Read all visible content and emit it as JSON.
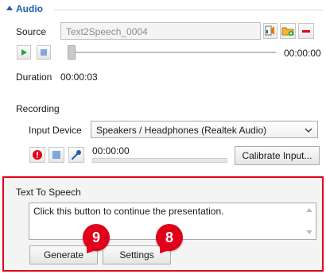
{
  "audio_section": {
    "title": "Audio",
    "source_label": "Source",
    "source_value": "Text2Speech_0004",
    "playback_time": "00:00:00",
    "duration_label": "Duration",
    "duration_value": "00:00:03"
  },
  "recording_section": {
    "title": "Recording",
    "input_device_label": "Input Device",
    "input_device_value": "Speakers / Headphones (Realtek Audio)",
    "record_time": "00:00:00",
    "calibrate_label": "Calibrate Input..."
  },
  "tts_section": {
    "title": "Text To Speech",
    "text": "Click this button to continue the presentation.",
    "generate_label": "Generate",
    "settings_label": "Settings"
  },
  "callouts": {
    "generate": "9",
    "settings": "8"
  },
  "colors": {
    "accent_blue": "#1f5fa8",
    "highlight_red": "#e0001a",
    "play_green": "#1aa342"
  },
  "icons": {
    "collapse": "triangle-up-icon",
    "import_audio": "audio-file-icon",
    "open_folder": "folder-icon",
    "remove": "minus-icon",
    "play": "play-icon",
    "stop": "stop-icon",
    "record": "record-icon",
    "mic": "microphone-icon"
  }
}
